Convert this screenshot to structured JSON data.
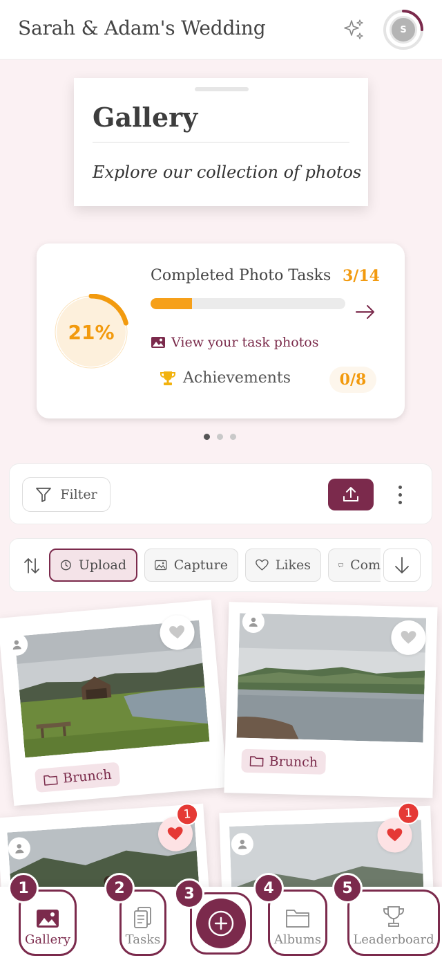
{
  "header": {
    "title": "Sarah & Adam's Wedding",
    "avatar_initial": "S"
  },
  "hero": {
    "title": "Gallery",
    "subtitle": "Explore our collection of photos"
  },
  "progress": {
    "percent_label": "21%",
    "percent_value": 0.21,
    "tasks_label": "Completed Photo Tasks",
    "tasks_count": "3/14",
    "tasks_fraction": 0.214,
    "view_photos_label": "View your task photos",
    "achievements_label": "Achievements",
    "achievements_count": "0/8",
    "carousel_dots": 3,
    "carousel_active": 0
  },
  "toolbar": {
    "filter_label": "Filter"
  },
  "sort": {
    "chips": [
      {
        "label": "Upload",
        "icon": "clock-icon",
        "active": true
      },
      {
        "label": "Capture",
        "icon": "image-icon",
        "active": false
      },
      {
        "label": "Likes",
        "icon": "heart-icon",
        "active": false
      },
      {
        "label": "Comments",
        "icon": "comment-icon",
        "active": false
      }
    ]
  },
  "photos": [
    {
      "album": "Brunch",
      "liked": false,
      "likes": ""
    },
    {
      "album": "Brunch",
      "liked": false,
      "likes": ""
    },
    {
      "album": "",
      "liked": true,
      "likes": "1"
    },
    {
      "album": "",
      "liked": true,
      "likes": "1"
    }
  ],
  "nav": {
    "items": [
      {
        "label": "Gallery",
        "number": "1",
        "icon": "gallery-icon"
      },
      {
        "label": "Tasks",
        "number": "2",
        "icon": "clipboard-icon"
      },
      {
        "label": "",
        "number": "3",
        "icon": "plus-icon"
      },
      {
        "label": "Albums",
        "number": "4",
        "icon": "folder-icon"
      },
      {
        "label": "Leaderboard",
        "number": "5",
        "icon": "trophy-icon"
      }
    ]
  },
  "colors": {
    "brand": "#7b2a4c",
    "accent": "#f29a0e",
    "like": "#e53935"
  }
}
